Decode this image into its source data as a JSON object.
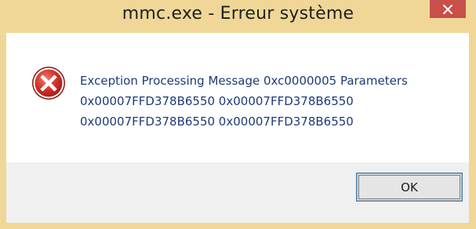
{
  "window": {
    "title": "mmc.exe - Erreur système",
    "frame_color": "#f0d797",
    "close_button_color": "#c7504a"
  },
  "dialog": {
    "icon": "error-icon",
    "message_lines": [
      "Exception Processing Message 0xc0000005 Parameters",
      "0x00007FFD378B6550 0x00007FFD378B6550",
      "0x00007FFD378B6550 0x00007FFD378B6550"
    ],
    "message_color": "#1e3a78"
  },
  "buttons": {
    "ok_label": "OK",
    "close_icon": "close-icon"
  }
}
